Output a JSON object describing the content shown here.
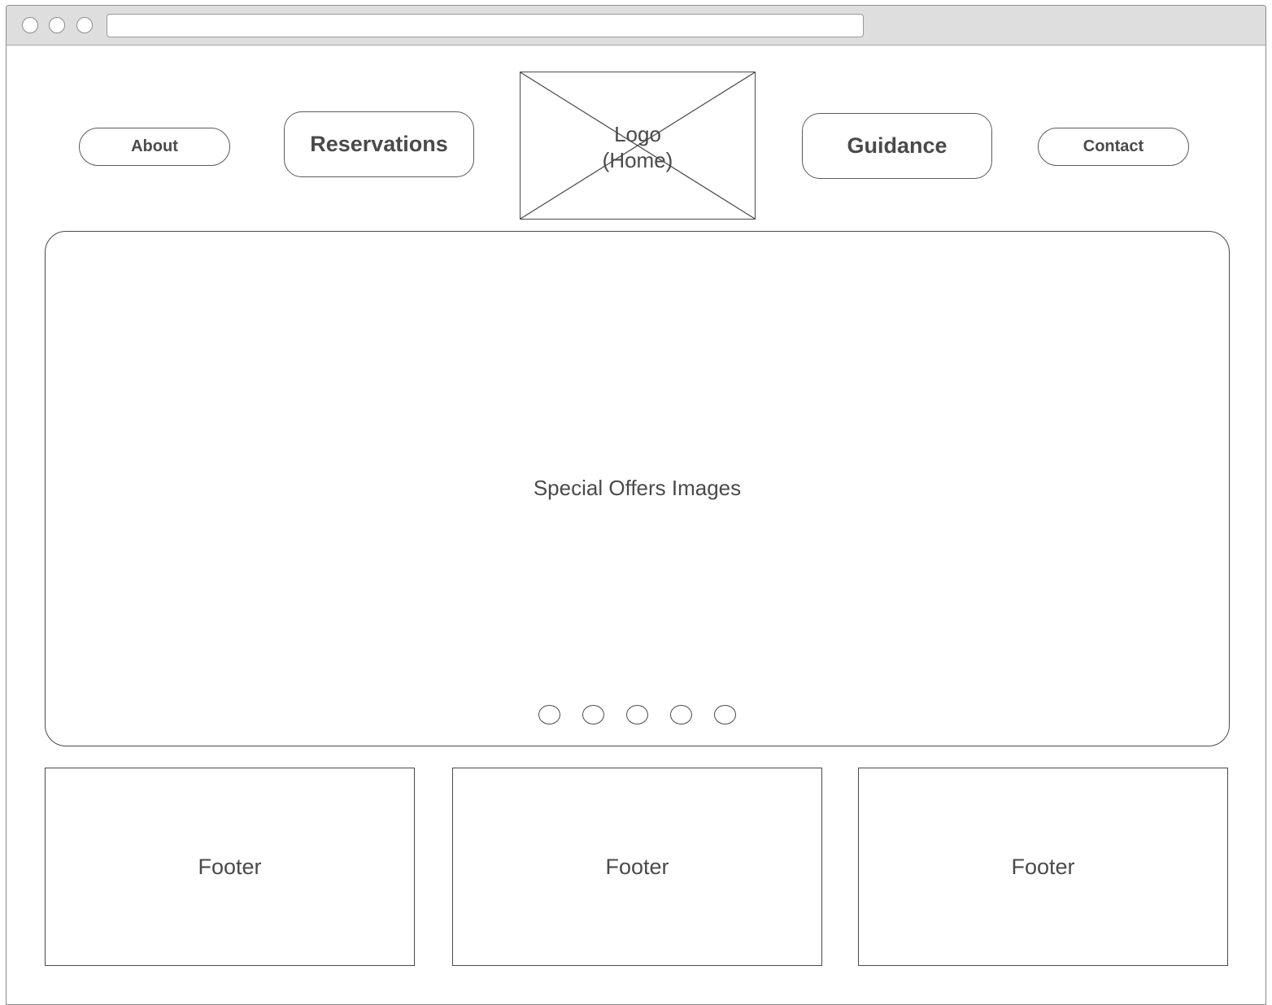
{
  "browser": {
    "address_bar_value": ""
  },
  "nav": {
    "about": "About",
    "reservations": "Reservations",
    "logo_line1": "Logo",
    "logo_line2": "(Home)",
    "guidance": "Guidance",
    "contact": "Contact"
  },
  "carousel": {
    "label": "Special Offers Images",
    "dot_count": 5
  },
  "footers": [
    {
      "label": "Footer"
    },
    {
      "label": "Footer"
    },
    {
      "label": "Footer"
    }
  ],
  "colors": {
    "stroke": "#4a4a4a",
    "titlebar": "#dedede",
    "background": "#ffffff"
  }
}
